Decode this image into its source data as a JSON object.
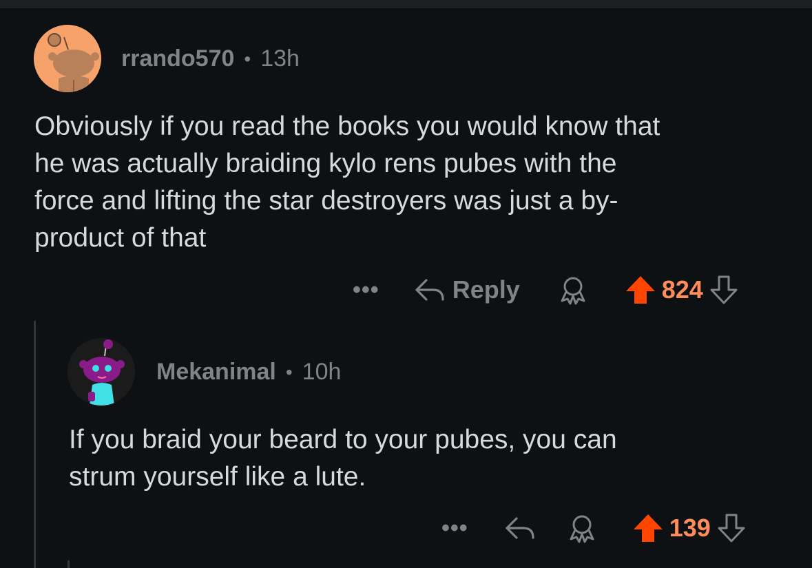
{
  "comments": [
    {
      "username": "rrando570",
      "separator": "•",
      "time": "13h",
      "text": "Obviously if you read the books you would know that he was actually braiding kylo rens pubes with the force and lifting the star destroyers was just a by-product of that",
      "lines": [
        "Obviously if you read the books you would know that",
        "he was actually braiding kylo rens pubes with the",
        "force and lifting the star destroyers was just a by-",
        "product of that"
      ],
      "more_label": "•••",
      "reply_label": "Reply",
      "score": "824"
    },
    {
      "username": "Mekanimal",
      "separator": "•",
      "time": "10h",
      "lines": [
        "If you braid your beard to your pubes, you can",
        "strum yourself like a lute."
      ],
      "more_label": "•••",
      "score": "139"
    }
  ],
  "icons": {
    "reply": "reply-arrow-icon",
    "award": "award-icon",
    "upvote": "upvote-arrow-icon",
    "downvote": "downvote-arrow-icon",
    "more": "more-icon"
  },
  "colors": {
    "background": "#0e1113",
    "upvote_active": "#ff4500",
    "score_active": "#ff8c5a",
    "muted": "#818384",
    "text": "#d7dadc"
  }
}
